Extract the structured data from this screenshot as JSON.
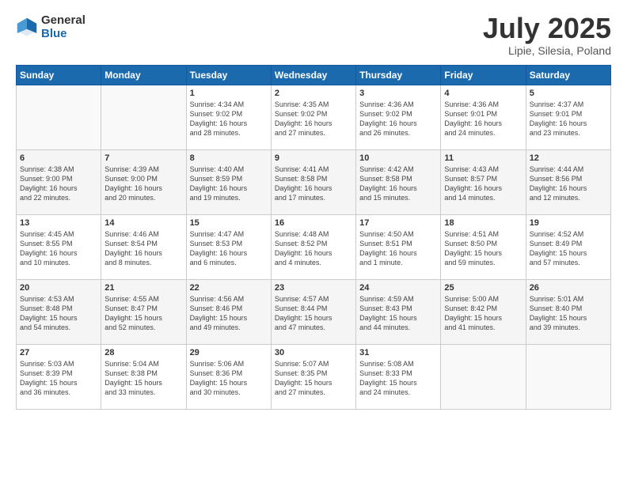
{
  "header": {
    "logo_general": "General",
    "logo_blue": "Blue",
    "title": "July 2025",
    "location": "Lipie, Silesia, Poland"
  },
  "days_of_week": [
    "Sunday",
    "Monday",
    "Tuesday",
    "Wednesday",
    "Thursday",
    "Friday",
    "Saturday"
  ],
  "weeks": [
    [
      {
        "day": "",
        "text": ""
      },
      {
        "day": "",
        "text": ""
      },
      {
        "day": "1",
        "text": "Sunrise: 4:34 AM\nSunset: 9:02 PM\nDaylight: 16 hours\nand 28 minutes."
      },
      {
        "day": "2",
        "text": "Sunrise: 4:35 AM\nSunset: 9:02 PM\nDaylight: 16 hours\nand 27 minutes."
      },
      {
        "day": "3",
        "text": "Sunrise: 4:36 AM\nSunset: 9:02 PM\nDaylight: 16 hours\nand 26 minutes."
      },
      {
        "day": "4",
        "text": "Sunrise: 4:36 AM\nSunset: 9:01 PM\nDaylight: 16 hours\nand 24 minutes."
      },
      {
        "day": "5",
        "text": "Sunrise: 4:37 AM\nSunset: 9:01 PM\nDaylight: 16 hours\nand 23 minutes."
      }
    ],
    [
      {
        "day": "6",
        "text": "Sunrise: 4:38 AM\nSunset: 9:00 PM\nDaylight: 16 hours\nand 22 minutes."
      },
      {
        "day": "7",
        "text": "Sunrise: 4:39 AM\nSunset: 9:00 PM\nDaylight: 16 hours\nand 20 minutes."
      },
      {
        "day": "8",
        "text": "Sunrise: 4:40 AM\nSunset: 8:59 PM\nDaylight: 16 hours\nand 19 minutes."
      },
      {
        "day": "9",
        "text": "Sunrise: 4:41 AM\nSunset: 8:58 PM\nDaylight: 16 hours\nand 17 minutes."
      },
      {
        "day": "10",
        "text": "Sunrise: 4:42 AM\nSunset: 8:58 PM\nDaylight: 16 hours\nand 15 minutes."
      },
      {
        "day": "11",
        "text": "Sunrise: 4:43 AM\nSunset: 8:57 PM\nDaylight: 16 hours\nand 14 minutes."
      },
      {
        "day": "12",
        "text": "Sunrise: 4:44 AM\nSunset: 8:56 PM\nDaylight: 16 hours\nand 12 minutes."
      }
    ],
    [
      {
        "day": "13",
        "text": "Sunrise: 4:45 AM\nSunset: 8:55 PM\nDaylight: 16 hours\nand 10 minutes."
      },
      {
        "day": "14",
        "text": "Sunrise: 4:46 AM\nSunset: 8:54 PM\nDaylight: 16 hours\nand 8 minutes."
      },
      {
        "day": "15",
        "text": "Sunrise: 4:47 AM\nSunset: 8:53 PM\nDaylight: 16 hours\nand 6 minutes."
      },
      {
        "day": "16",
        "text": "Sunrise: 4:48 AM\nSunset: 8:52 PM\nDaylight: 16 hours\nand 4 minutes."
      },
      {
        "day": "17",
        "text": "Sunrise: 4:50 AM\nSunset: 8:51 PM\nDaylight: 16 hours\nand 1 minute."
      },
      {
        "day": "18",
        "text": "Sunrise: 4:51 AM\nSunset: 8:50 PM\nDaylight: 15 hours\nand 59 minutes."
      },
      {
        "day": "19",
        "text": "Sunrise: 4:52 AM\nSunset: 8:49 PM\nDaylight: 15 hours\nand 57 minutes."
      }
    ],
    [
      {
        "day": "20",
        "text": "Sunrise: 4:53 AM\nSunset: 8:48 PM\nDaylight: 15 hours\nand 54 minutes."
      },
      {
        "day": "21",
        "text": "Sunrise: 4:55 AM\nSunset: 8:47 PM\nDaylight: 15 hours\nand 52 minutes."
      },
      {
        "day": "22",
        "text": "Sunrise: 4:56 AM\nSunset: 8:46 PM\nDaylight: 15 hours\nand 49 minutes."
      },
      {
        "day": "23",
        "text": "Sunrise: 4:57 AM\nSunset: 8:44 PM\nDaylight: 15 hours\nand 47 minutes."
      },
      {
        "day": "24",
        "text": "Sunrise: 4:59 AM\nSunset: 8:43 PM\nDaylight: 15 hours\nand 44 minutes."
      },
      {
        "day": "25",
        "text": "Sunrise: 5:00 AM\nSunset: 8:42 PM\nDaylight: 15 hours\nand 41 minutes."
      },
      {
        "day": "26",
        "text": "Sunrise: 5:01 AM\nSunset: 8:40 PM\nDaylight: 15 hours\nand 39 minutes."
      }
    ],
    [
      {
        "day": "27",
        "text": "Sunrise: 5:03 AM\nSunset: 8:39 PM\nDaylight: 15 hours\nand 36 minutes."
      },
      {
        "day": "28",
        "text": "Sunrise: 5:04 AM\nSunset: 8:38 PM\nDaylight: 15 hours\nand 33 minutes."
      },
      {
        "day": "29",
        "text": "Sunrise: 5:06 AM\nSunset: 8:36 PM\nDaylight: 15 hours\nand 30 minutes."
      },
      {
        "day": "30",
        "text": "Sunrise: 5:07 AM\nSunset: 8:35 PM\nDaylight: 15 hours\nand 27 minutes."
      },
      {
        "day": "31",
        "text": "Sunrise: 5:08 AM\nSunset: 8:33 PM\nDaylight: 15 hours\nand 24 minutes."
      },
      {
        "day": "",
        "text": ""
      },
      {
        "day": "",
        "text": ""
      }
    ]
  ]
}
